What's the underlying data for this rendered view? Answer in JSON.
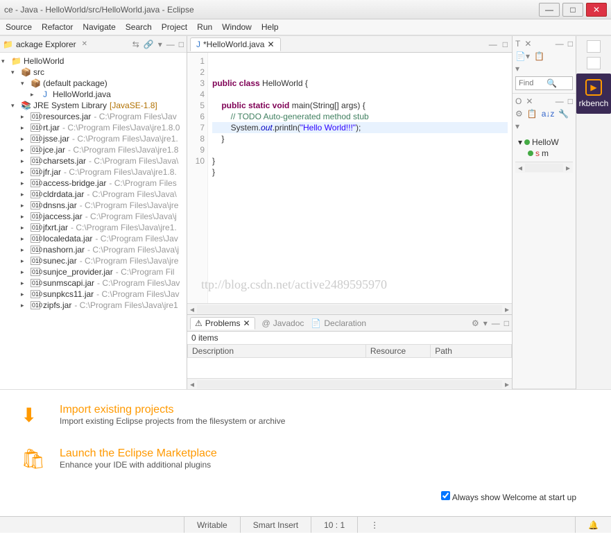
{
  "title": "ce - Java - HelloWorld/src/HelloWorld.java - Eclipse",
  "menu": [
    "Source",
    "Refactor",
    "Navigate",
    "Search",
    "Project",
    "Run",
    "Window",
    "Help"
  ],
  "pkgExplorer": {
    "title": "ackage Explorer",
    "project": "HelloWorld",
    "src": "src",
    "defpkg": "(default package)",
    "file": "HelloWorld.java",
    "jre": "JRE System Library",
    "jreProfile": "[JavaSE-1.8]",
    "jars": [
      {
        "n": "resources.jar",
        "p": " - C:\\Program Files\\Jav"
      },
      {
        "n": "rt.jar",
        "p": " - C:\\Program Files\\Java\\jre1.8.0"
      },
      {
        "n": "jsse.jar",
        "p": " - C:\\Program Files\\Java\\jre1."
      },
      {
        "n": "jce.jar",
        "p": " - C:\\Program Files\\Java\\jre1.8"
      },
      {
        "n": "charsets.jar",
        "p": " - C:\\Program Files\\Java\\"
      },
      {
        "n": "jfr.jar",
        "p": " - C:\\Program Files\\Java\\jre1.8."
      },
      {
        "n": "access-bridge.jar",
        "p": " - C:\\Program Files"
      },
      {
        "n": "cldrdata.jar",
        "p": " - C:\\Program Files\\Java\\"
      },
      {
        "n": "dnsns.jar",
        "p": " - C:\\Program Files\\Java\\jre"
      },
      {
        "n": "jaccess.jar",
        "p": " - C:\\Program Files\\Java\\j"
      },
      {
        "n": "jfxrt.jar",
        "p": " - C:\\Program Files\\Java\\jre1."
      },
      {
        "n": "localedata.jar",
        "p": " - C:\\Program Files\\Jav"
      },
      {
        "n": "nashorn.jar",
        "p": " - C:\\Program Files\\Java\\j"
      },
      {
        "n": "sunec.jar",
        "p": " - C:\\Program Files\\Java\\jre"
      },
      {
        "n": "sunjce_provider.jar",
        "p": " - C:\\Program Fil"
      },
      {
        "n": "sunmscapi.jar",
        "p": " - C:\\Program Files\\Jav"
      },
      {
        "n": "sunpkcs11.jar",
        "p": " - C:\\Program Files\\Jav"
      },
      {
        "n": "zipfs.jar",
        "p": " - C:\\Program Files\\Java\\jre1"
      }
    ]
  },
  "editor": {
    "tab": "*HelloWorld.java",
    "lines": [
      "1",
      "2",
      "3",
      "4",
      "5",
      "6",
      "7",
      "8",
      "9",
      "10"
    ],
    "code": {
      "l2a": "public",
      "l2b": " class",
      "l2c": " HelloWorld {",
      "l4a": "    public static void",
      "l4b": " main(String[] args) {",
      "l5a": "        // ",
      "l5b": "TODO",
      "l5c": " Auto-generated method stub",
      "l6a": "        System.",
      "l6b": "out",
      "l6c": ".println(",
      "l6d": "\"Hello World!!!\"",
      "l6e": ");",
      "l7": "    }",
      "l9": "}",
      "l10": "}"
    }
  },
  "watermark": "ttp://blog.csdn.net/active2489595970",
  "problems": {
    "tab1": "Problems",
    "tab2": "Javadoc",
    "tab3": "Declaration",
    "count": "0 items",
    "cols": [
      "Description",
      "Resource",
      "Path"
    ]
  },
  "taskview": {
    "label": "T",
    "find": "Find"
  },
  "outline": {
    "label": "O",
    "cls": "HelloW",
    "meth": "m"
  },
  "workbench": "rkbench",
  "welcome": {
    "import_t": "Import existing projects",
    "import_d": "Import existing Eclipse projects from the filesystem or archive",
    "market_t": "Launch the Eclipse Marketplace",
    "market_d": "Enhance your IDE with additional plugins",
    "chk": "Always show Welcome at start up"
  },
  "status": {
    "writable": "Writable",
    "insert": "Smart Insert",
    "pos": "10 : 1"
  }
}
